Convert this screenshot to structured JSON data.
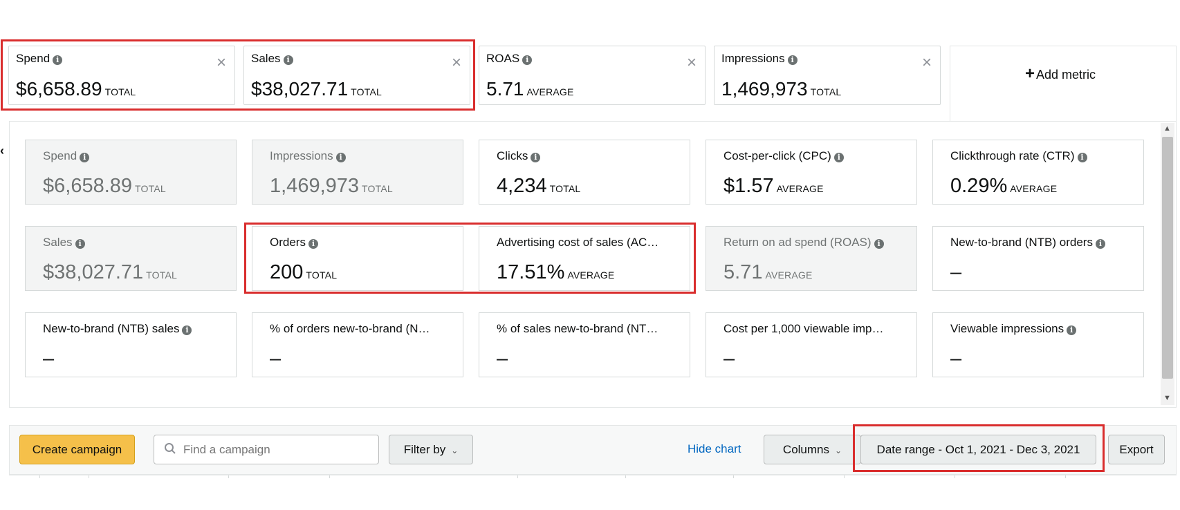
{
  "top_metrics": [
    {
      "label": "Spend",
      "value": "$6,658.89",
      "suffix": "TOTAL"
    },
    {
      "label": "Sales",
      "value": "$38,027.71",
      "suffix": "TOTAL"
    },
    {
      "label": "ROAS",
      "value": "5.71",
      "suffix": "AVERAGE"
    },
    {
      "label": "Impressions",
      "value": "1,469,973",
      "suffix": "TOTAL"
    }
  ],
  "close_glyph": "×",
  "add_metric": {
    "plus": "+",
    "label": "Add metric"
  },
  "metric_tiles": [
    {
      "label": "Spend",
      "value": "$6,658.89",
      "suffix": "TOTAL",
      "state": "selected"
    },
    {
      "label": "Impressions",
      "value": "1,469,973",
      "suffix": "TOTAL",
      "state": "selected"
    },
    {
      "label": "Clicks",
      "value": "4,234",
      "suffix": "TOTAL",
      "state": "available"
    },
    {
      "label": "Cost-per-click (CPC)",
      "value": "$1.57",
      "suffix": "AVERAGE",
      "state": "available"
    },
    {
      "label": "Clickthrough rate (CTR)",
      "value": "0.29%",
      "suffix": "AVERAGE",
      "state": "available"
    },
    {
      "label": "Sales",
      "value": "$38,027.71",
      "suffix": "TOTAL",
      "state": "selected"
    },
    {
      "label": "Orders",
      "value": "200",
      "suffix": "TOTAL",
      "state": "available"
    },
    {
      "label": "Advertising cost of sales (AC…",
      "value": "17.51%",
      "suffix": "AVERAGE",
      "state": "available"
    },
    {
      "label": "Return on ad spend (ROAS)",
      "value": "5.71",
      "suffix": "AVERAGE",
      "state": "selected"
    },
    {
      "label": "New-to-brand (NTB) orders",
      "value": "–",
      "suffix": "",
      "state": "available"
    },
    {
      "label": "New-to-brand (NTB) sales",
      "value": "–",
      "suffix": "",
      "state": "available"
    },
    {
      "label": "% of orders new-to-brand (N…",
      "value": "–",
      "suffix": "",
      "state": "available"
    },
    {
      "label": "% of sales new-to-brand (NT…",
      "value": "–",
      "suffix": "",
      "state": "available"
    },
    {
      "label": "Cost per 1,000 viewable imp…",
      "value": "–",
      "suffix": "",
      "state": "available"
    },
    {
      "label": "Viewable impressions",
      "value": "–",
      "suffix": "",
      "state": "available"
    }
  ],
  "toolbar": {
    "create_campaign": "Create campaign",
    "search_placeholder": "Find a campaign",
    "filter_by": "Filter by",
    "hide_chart": "Hide chart",
    "columns": "Columns",
    "date_range": "Date range - Oct 1, 2021 - Dec 3, 2021",
    "export": "Export"
  },
  "colors": {
    "accent_button": "#f5c04a",
    "link": "#0066c0",
    "highlight": "#d92d2d",
    "selected_tile_bg": "#f3f4f4"
  },
  "icons": {
    "info": "info-icon",
    "close": "close-icon",
    "search": "search-icon",
    "chevron": "chevron-down-icon"
  }
}
